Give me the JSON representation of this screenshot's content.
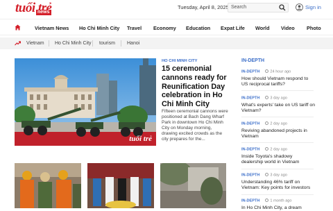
{
  "header": {
    "logo_main": "tuổi trẻ",
    "logo_sub": "news",
    "date": "Tuesday, April 8, 2025",
    "search_placeholder": "Search",
    "signin": "Sign in"
  },
  "nav": {
    "items": [
      "Vietnam News",
      "Ho Chi Minh City",
      "Travel",
      "Economy",
      "Education",
      "Expat Life",
      "World",
      "Video",
      "Photo"
    ]
  },
  "trending": [
    "Vietnam",
    "Ho Chi Minh City",
    "tourism",
    "Hanoi"
  ],
  "hero": {
    "kicker": "HO CHI MINH CITY",
    "title": "15 ceremonial cannons ready for Reunification Day celebration in Ho Chi Minh City",
    "summary": "Fifteen ceremonial cannons were positioned at Bach Dang Wharf Park in downtown Ho Chi Minh City on Monday morning, drawing excited crowds as the city prepares for the...",
    "watermark": "tuổi trẻ"
  },
  "sidebar": {
    "title": "IN-DEPTH",
    "items": [
      {
        "kicker": "IN-DEPTH",
        "time": "24 hour ago",
        "title": "How should Vietnam respond to US reciprocal tariffs?"
      },
      {
        "kicker": "IN-DEPTH",
        "time": "3 day ago",
        "title": "What's experts' take on US tariff on Vietnam?"
      },
      {
        "kicker": "IN-DEPTH",
        "time": "2 day ago",
        "title": "Reviving abandoned projects in Vietnam"
      },
      {
        "kicker": "IN-DEPTH",
        "time": "2 day ago",
        "title": "Inside Toyota's shadowy dealership world in Vietnam"
      },
      {
        "kicker": "IN-DEPTH",
        "time": "3 day ago",
        "title": "Understanding 46% tariff on Vietnam: Key points for investors"
      },
      {
        "kicker": "IN-DEPTH",
        "time": "1 month ago",
        "title": "In Ho Chi Minh City, a dream"
      }
    ]
  },
  "colors": {
    "brand": "#d4202a",
    "accent": "#3b6ec9"
  }
}
